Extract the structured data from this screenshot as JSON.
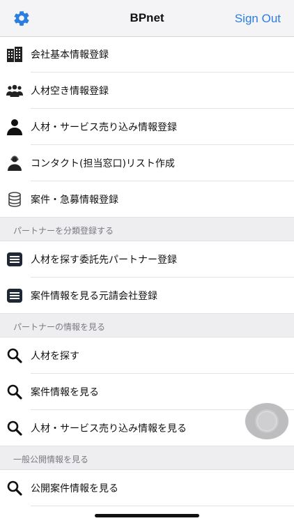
{
  "navbar": {
    "title": "BPnet",
    "signout": "Sign Out",
    "settings_icon": "gear-icon",
    "accent_color": "#2a7ee0"
  },
  "sections": [
    {
      "header": "",
      "items": [
        {
          "label": "会社基本情報登録",
          "icon": "building-icon"
        },
        {
          "label": "人材空き情報登録",
          "icon": "people-group-icon"
        },
        {
          "label": "人材・サービス売り込み情報登録",
          "icon": "person-icon"
        },
        {
          "label": "コンタクト(担当窓口)リスト作成",
          "icon": "contact-person-icon"
        },
        {
          "label": "案件・急募情報登録",
          "icon": "database-icon"
        }
      ]
    },
    {
      "header": "パートナーを分類登録する",
      "items": [
        {
          "label": "人材を探す委託先パートナー登録",
          "icon": "list-icon"
        },
        {
          "label": "案件情報を見る元請会社登録",
          "icon": "list-icon"
        }
      ]
    },
    {
      "header": "パートナーの情報を見る",
      "items": [
        {
          "label": "人材を探す",
          "icon": "search-icon"
        },
        {
          "label": "案件情報を見る",
          "icon": "search-icon"
        },
        {
          "label": "人材・サービス売り込み情報を見る",
          "icon": "search-icon"
        }
      ]
    },
    {
      "header": "一般公開情報を見る",
      "items": [
        {
          "label": "公開案件情報を見る",
          "icon": "search-icon"
        }
      ]
    }
  ],
  "floating_button": {
    "icon": "assistive-touch-icon"
  }
}
